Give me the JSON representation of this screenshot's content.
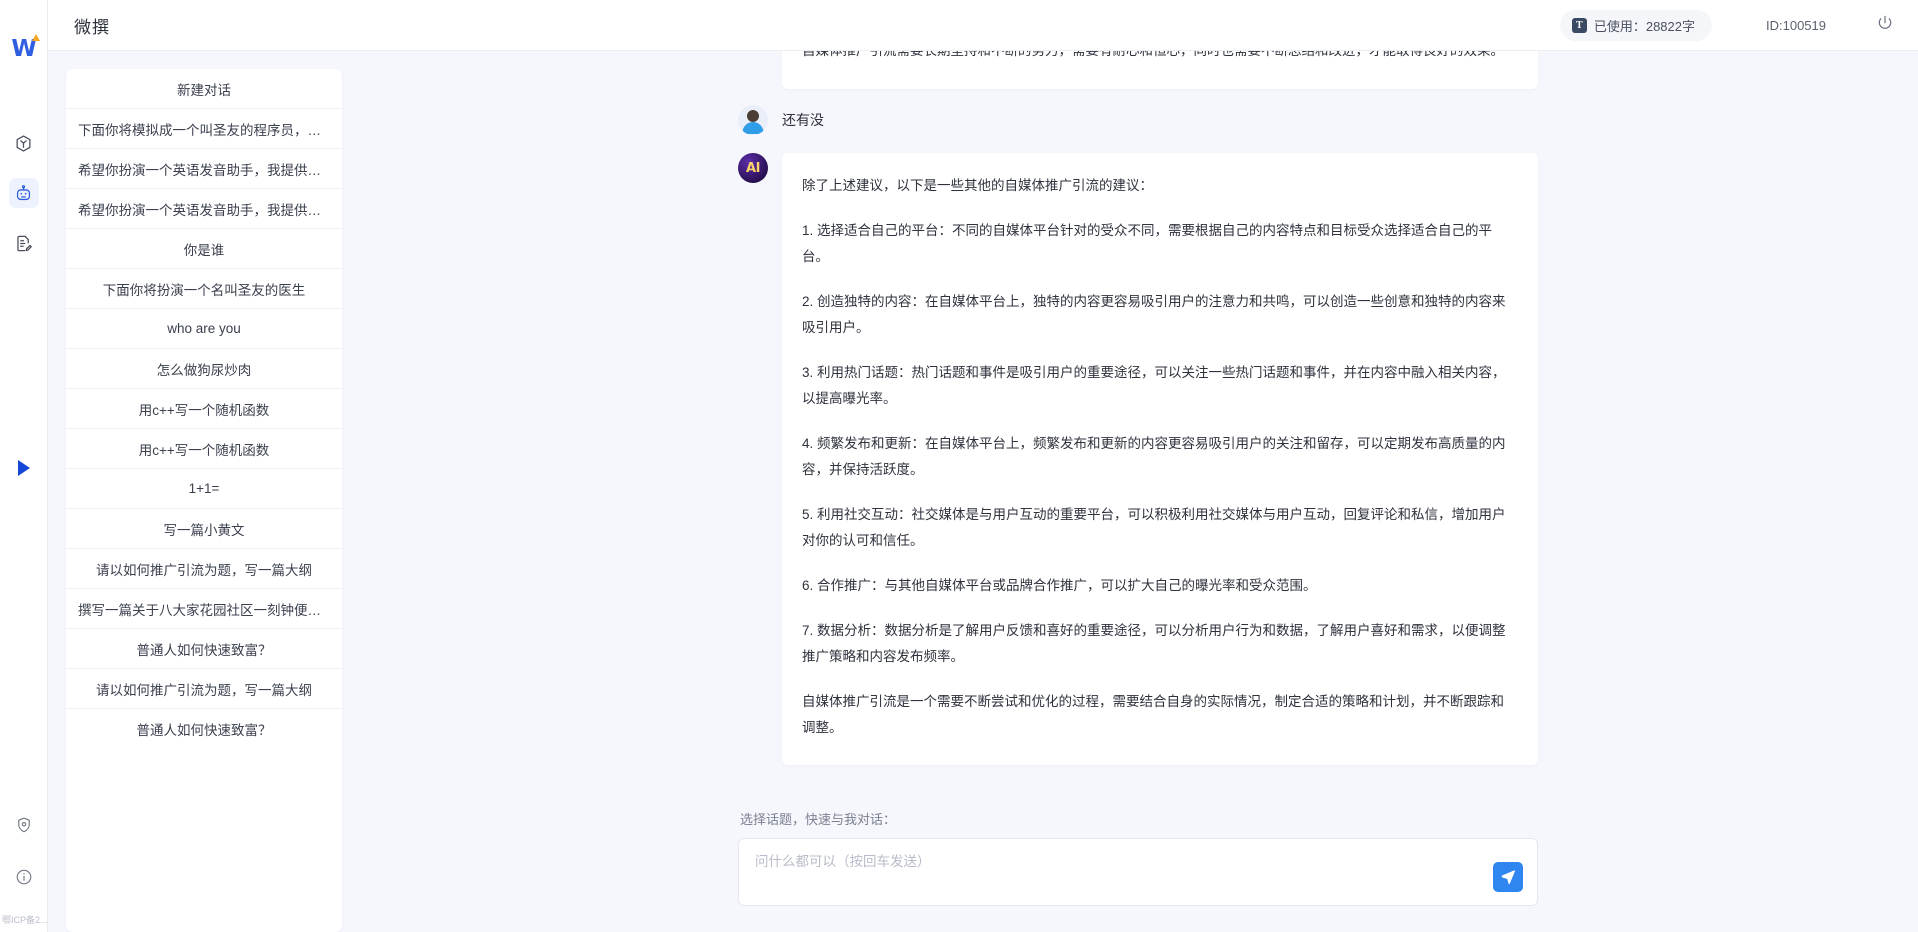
{
  "rail": {
    "logo_text": "W",
    "icons": [
      {
        "name": "cube-icon",
        "label": "模型"
      },
      {
        "name": "robot-icon",
        "label": "AI助手",
        "active": true
      },
      {
        "name": "document-edit-icon",
        "label": "文档编辑"
      }
    ],
    "expand_label": "展开",
    "bottom_icons": [
      {
        "name": "shield-icon",
        "label": "安全"
      },
      {
        "name": "info-icon",
        "label": "关于"
      }
    ],
    "footer_text": "鄂ICP备2..."
  },
  "header": {
    "title": "微撰",
    "usage_label": "已使用：28822字",
    "usage_icon_text": "T",
    "user_id": "ID:100519",
    "power_label": "退出"
  },
  "conversations": {
    "new_chat_label": "新建对话",
    "items": [
      "下面你将模拟成一个叫圣友的程序员，我说...",
      "希望你扮演一个英语发音助手，我提供给你...",
      "希望你扮演一个英语发音助手，我提供给你...",
      "你是谁",
      "下面你将扮演一个名叫圣友的医生",
      "who are you",
      "怎么做狗尿炒肉",
      "用c++写一个随机函数",
      "用c++写一个随机函数",
      "1+1=",
      "写一篇小黄文",
      "请以如何推广引流为题，写一篇大纲",
      "撰写一篇关于八大家花园社区一刻钟便民生...",
      "普通人如何快速致富？",
      "请以如何推广引流为题，写一篇大纲",
      "普通人如何快速致富？"
    ]
  },
  "chat": {
    "clipped_message": "自媒体推广引流需要长期坚持和不断的努力，需要有耐心和恒心，同时也需要不断总结和改进，才能取得良好的效果。",
    "messages": [
      {
        "role": "user",
        "avatar_name": "user-avatar",
        "text": "还有没"
      },
      {
        "role": "assistant",
        "avatar_name": "ai-avatar",
        "avatar_text": "AI",
        "paragraphs": [
          "除了上述建议，以下是一些其他的自媒体推广引流的建议：",
          "1. 选择适合自己的平台：不同的自媒体平台针对的受众不同，需要根据自己的内容特点和目标受众选择适合自己的平台。",
          "2. 创造独特的内容：在自媒体平台上，独特的内容更容易吸引用户的注意力和共鸣，可以创造一些创意和独特的内容来吸引用户。",
          "3. 利用热门话题：热门话题和事件是吸引用户的重要途径，可以关注一些热门话题和事件，并在内容中融入相关内容，以提高曝光率。",
          "4. 频繁发布和更新：在自媒体平台上，频繁发布和更新的内容更容易吸引用户的关注和留存，可以定期发布高质量的内容，并保持活跃度。",
          "5. 利用社交互动：社交媒体是与用户互动的重要平台，可以积极利用社交媒体与用户互动，回复评论和私信，增加用户对你的认可和信任。",
          "6. 合作推广：与其他自媒体平台或品牌合作推广，可以扩大自己的曝光率和受众范围。",
          "7. 数据分析：数据分析是了解用户反馈和喜好的重要途径，可以分析用户行为和数据，了解用户喜好和需求，以便调整推广策略和内容发布频率。",
          "自媒体推广引流是一个需要不断尝试和优化的过程，需要结合自身的实际情况，制定合适的策略和计划，并不断跟踪和调整。"
        ]
      }
    ]
  },
  "composer": {
    "label": "选择话题，快速与我对话：",
    "placeholder": "问什么都可以（按回车发送）",
    "value": "",
    "send_label": "发送"
  },
  "colors": {
    "accent": "#2f5fe0",
    "send_blue": "#2f86f0",
    "page_bg": "#f6f7fc",
    "card_bg": "#ffffff"
  }
}
